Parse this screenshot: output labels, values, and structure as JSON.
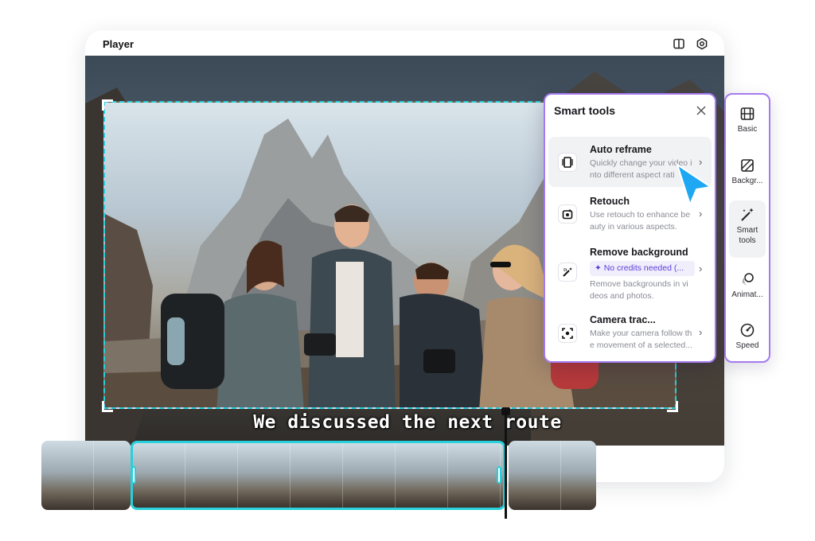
{
  "player": {
    "title": "Player",
    "header_icons": [
      "layout-toggle-icon",
      "settings-icon"
    ],
    "subtitle": "We discussed the next route"
  },
  "smart_tools": {
    "title": "Smart tools",
    "items": [
      {
        "name": "Auto reframe",
        "icon": "reframe-icon",
        "description_line1": "Quickly change your video i",
        "description_line2": "nto different aspect rati",
        "active": true
      },
      {
        "name": "Retouch",
        "icon": "retouch-icon",
        "description_line1": "Use retouch to enhance be",
        "description_line2": "auty in various aspects."
      },
      {
        "name": "Remove background",
        "icon": "magic-wand-icon",
        "badge": "✦ No credits needed (...",
        "description_line1": "Remove backgrounds in vi",
        "description_line2": "deos and photos."
      },
      {
        "name": "Camera trac...",
        "icon": "focus-target-icon",
        "description_line1": "Make your camera follow th",
        "description_line2": "e movement of a selected..."
      }
    ]
  },
  "side_rail": {
    "items": [
      {
        "label": "Basic",
        "icon": "film-icon"
      },
      {
        "label": "Backgr...",
        "icon": "background-icon"
      },
      {
        "label_line1": "Smart",
        "label_line2": "tools",
        "icon": "magic-wand-icon",
        "active": true
      },
      {
        "label": "Animat...",
        "icon": "animation-icon"
      },
      {
        "label": "Speed",
        "icon": "speed-gauge-icon"
      }
    ]
  },
  "colors": {
    "accent_cyan": "#27d0dc",
    "panel_border": "#a57af0",
    "cursor_blue": "#1ea7f2",
    "badge_purple": "#5b3fd6"
  }
}
